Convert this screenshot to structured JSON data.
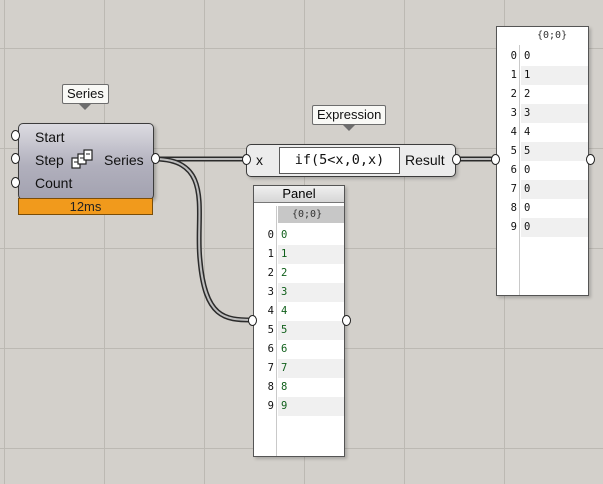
{
  "series_component": {
    "tag": "Series",
    "inputs": [
      "Start",
      "Step",
      "Count"
    ],
    "output": "Series",
    "timing": "12ms",
    "icon": "series-icon"
  },
  "expression_component": {
    "tag": "Expression",
    "input": "x",
    "expression": "if(5<x,0,x)",
    "output": "Result"
  },
  "panel_left": {
    "title": "Panel",
    "path": "{0;0}",
    "rows": [
      {
        "i": "0",
        "v": "0"
      },
      {
        "i": "1",
        "v": "1"
      },
      {
        "i": "2",
        "v": "2"
      },
      {
        "i": "3",
        "v": "3"
      },
      {
        "i": "4",
        "v": "4"
      },
      {
        "i": "5",
        "v": "5"
      },
      {
        "i": "6",
        "v": "6"
      },
      {
        "i": "7",
        "v": "7"
      },
      {
        "i": "8",
        "v": "8"
      },
      {
        "i": "9",
        "v": "9"
      }
    ]
  },
  "panel_right": {
    "path": "{0;0}",
    "rows": [
      {
        "i": "0",
        "v": "0"
      },
      {
        "i": "1",
        "v": "1"
      },
      {
        "i": "2",
        "v": "2"
      },
      {
        "i": "3",
        "v": "3"
      },
      {
        "i": "4",
        "v": "4"
      },
      {
        "i": "5",
        "v": "5"
      },
      {
        "i": "6",
        "v": "0"
      },
      {
        "i": "7",
        "v": "0"
      },
      {
        "i": "8",
        "v": "0"
      },
      {
        "i": "9",
        "v": "0"
      }
    ]
  },
  "colors": {
    "canvas": "#d3d0cb",
    "timing_bar": "#f19a1c",
    "panel_text": "#0f5f1a"
  }
}
